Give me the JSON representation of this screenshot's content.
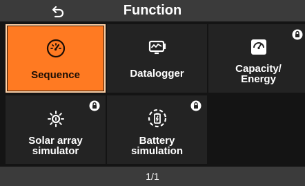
{
  "header": {
    "title": "Function",
    "back_icon": "back-arrow-icon"
  },
  "tiles": [
    {
      "label": "Sequence",
      "icon": "speedometer-icon",
      "selected": true,
      "locked": false
    },
    {
      "label": "Datalogger",
      "icon": "monitor-graph-icon",
      "selected": false,
      "locked": false
    },
    {
      "label_line1": "Capacity/",
      "label_line2": "Energy",
      "icon": "gauge-meter-icon",
      "selected": false,
      "locked": true
    },
    {
      "label_line1": "Solar array",
      "label_line2": "simulator",
      "icon": "sun-icon",
      "selected": false,
      "locked": true
    },
    {
      "label_line1": "Battery",
      "label_line2": "simulation",
      "icon": "battery-charge-icon",
      "selected": false,
      "locked": true
    }
  ],
  "footer": {
    "page_indicator": "1/1"
  },
  "colors": {
    "accent": "#ff7a22",
    "tile": "#232323",
    "bar": "#3b3b3b",
    "background": "#141414"
  }
}
